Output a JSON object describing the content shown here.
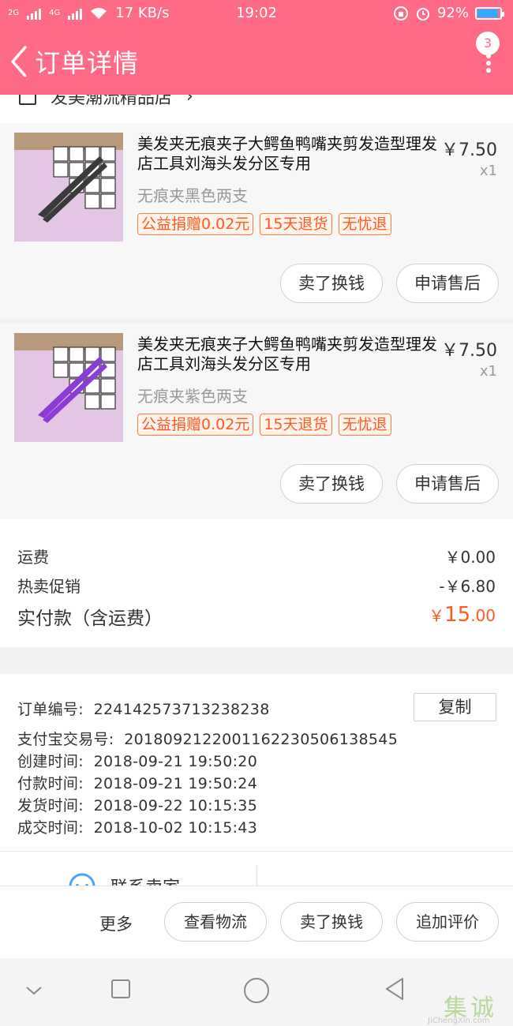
{
  "status_bar": {
    "network_left": "2G",
    "network_right": "4G",
    "speed": "17 KB/s",
    "time": "19:02",
    "battery": "92%",
    "battery_level": 0.92
  },
  "header": {
    "title": "订单详情",
    "badge": "3"
  },
  "shop": {
    "name": "发美潮流精品店"
  },
  "products": [
    {
      "name": "美发夹无痕夹子大鳄鱼鸭嘴夹剪发造型理发店工具刘海头发分区专用",
      "price": "￥7.50",
      "qty": "x1",
      "sku": "无痕夹黑色两支",
      "clip_color": "#3a3a3a",
      "tags": [
        "公益捐赠0.02元",
        "15天退货",
        "无忧退"
      ],
      "buttons": [
        "卖了换钱",
        "申请售后"
      ]
    },
    {
      "name": "美发夹无痕夹子大鳄鱼鸭嘴夹剪发造型理发店工具刘海头发分区专用",
      "price": "￥7.50",
      "qty": "x1",
      "sku": "无痕夹紫色两支",
      "clip_color": "#8c3cd6",
      "tags": [
        "公益捐赠0.02元",
        "15天退货",
        "无忧退"
      ],
      "buttons": [
        "卖了换钱",
        "申请售后"
      ]
    }
  ],
  "summary": {
    "shipping_label": "运费",
    "shipping_value": "￥0.00",
    "promo_label": "热卖促销",
    "promo_value": "-￥6.80",
    "total_label": "实付款（含运费）",
    "total_currency": "￥",
    "total_int": "15",
    "total_dec": ".00"
  },
  "order": {
    "number_label": "订单编号:",
    "number": "224142573713238238",
    "copy_label": "复制",
    "alipay_label": "支付宝交易号:",
    "alipay": "2018092122001162230506138545",
    "created_label": "创建时间:",
    "created": "2018-09-21 19:50:20",
    "paid_label": "付款时间:",
    "paid": "2018-09-21 19:50:24",
    "shipped_label": "发货时间:",
    "shipped": "2018-09-22 10:15:35",
    "done_label": "成交时间:",
    "done": "2018-10-02 10:15:43"
  },
  "contact": {
    "label": "联系卖家"
  },
  "actions": {
    "more": "更多",
    "logistics": "查看物流",
    "sell": "卖了换钱",
    "review": "追加评价"
  },
  "watermark": {
    "text": "集诚信",
    "sub": "JiChengXin.com"
  },
  "colors": {
    "brand": "#ff6b86",
    "accent": "#ff5a1f"
  }
}
